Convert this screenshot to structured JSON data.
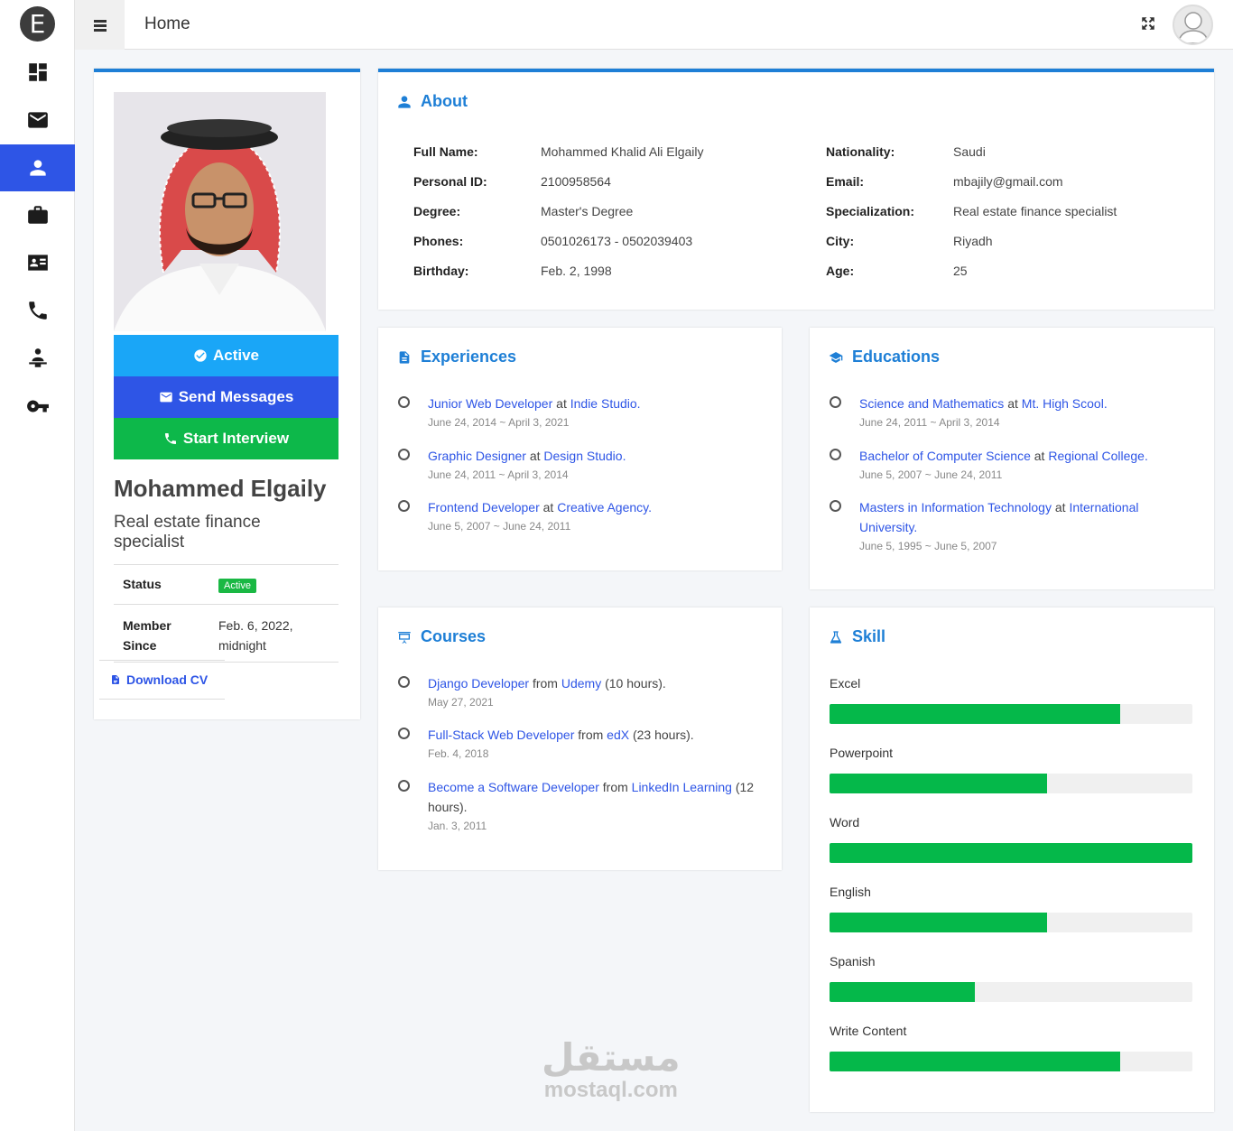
{
  "sidebar": {
    "logo": "E",
    "items": [
      {
        "name": "dashboard-icon"
      },
      {
        "name": "mail-icon"
      },
      {
        "name": "user-icon",
        "active": true
      },
      {
        "name": "briefcase-icon"
      },
      {
        "name": "id-card-icon"
      },
      {
        "name": "phone-icon"
      },
      {
        "name": "person-desk-icon"
      },
      {
        "name": "key-icon"
      }
    ]
  },
  "topbar": {
    "title": "Home"
  },
  "profile": {
    "buttons": {
      "active": "Active",
      "send": "Send Messages",
      "interview": "Start Interview"
    },
    "name": "Mohammed Elgaily",
    "title": "Real estate finance specialist",
    "status_label": "Status",
    "status_value": "Active",
    "member_label": "Member Since",
    "member_value": "Feb. 6, 2022, midnight",
    "download": "Download CV",
    "colors": {
      "active": "#1aa6f7",
      "send": "#2e55e6",
      "interview": "#0db84a"
    }
  },
  "about": {
    "title": "About",
    "left": [
      {
        "k": "Full Name:",
        "v": "Mohammed Khalid Ali Elgaily"
      },
      {
        "k": "Personal ID:",
        "v": "2100958564"
      },
      {
        "k": "Degree:",
        "v": "Master's Degree"
      },
      {
        "k": "Phones:",
        "v": "0501026173 - 0502039403"
      },
      {
        "k": "Birthday:",
        "v": "Feb. 2, 1998"
      }
    ],
    "right": [
      {
        "k": "Nationality:",
        "v": "Saudi"
      },
      {
        "k": "Email:",
        "v": "mbajily@gmail.com"
      },
      {
        "k": "Specialization:",
        "v": "Real estate finance specialist"
      },
      {
        "k": "City:",
        "v": "Riyadh"
      },
      {
        "k": "Age:",
        "v": "25"
      }
    ]
  },
  "experiences": {
    "title": "Experiences",
    "items": [
      {
        "role": "Junior Web Developer",
        "sep": "at",
        "org": "Indie Studio.",
        "date": "June 24, 2014 ~ April 3, 2021"
      },
      {
        "role": "Graphic Designer",
        "sep": "at",
        "org": "Design Studio.",
        "date": "June 24, 2011 ~ April 3, 2014"
      },
      {
        "role": "Frontend Developer",
        "sep": "at",
        "org": "Creative Agency.",
        "date": "June 5, 2007 ~ June 24, 2011"
      }
    ]
  },
  "educations": {
    "title": "Educations",
    "items": [
      {
        "role": "Science and Mathematics",
        "sep": "at",
        "org": "Mt. High Scool.",
        "date": "June 24, 2011 ~ April 3, 2014"
      },
      {
        "role": "Bachelor of Computer Science",
        "sep": "at",
        "org": "Regional College.",
        "date": "June 5, 2007 ~ June 24, 2011"
      },
      {
        "role": "Masters in Information Technology",
        "sep": "at",
        "org": "International University.",
        "date": "June 5, 1995 ~ June 5, 2007"
      }
    ]
  },
  "courses": {
    "title": "Courses",
    "items": [
      {
        "role": "Django Developer",
        "sep": "from",
        "org": "Udemy",
        "extra": "(10 hours).",
        "date": "May 27, 2021"
      },
      {
        "role": "Full-Stack Web Developer",
        "sep": "from",
        "org": "edX",
        "extra": "(23 hours).",
        "date": "Feb. 4, 2018"
      },
      {
        "role": "Become a Software Developer",
        "sep": "from",
        "org": "LinkedIn Learning",
        "extra": "(12 hours).",
        "date": "Jan. 3, 2011"
      }
    ]
  },
  "skills": {
    "title": "Skill",
    "items": [
      {
        "name": "Excel",
        "level": 0.8
      },
      {
        "name": "Powerpoint",
        "level": 0.6
      },
      {
        "name": "Word",
        "level": 1.0
      },
      {
        "name": "English",
        "level": 0.6
      },
      {
        "name": "Spanish",
        "level": 0.4
      },
      {
        "name": "Write Content",
        "level": 0.8
      }
    ]
  },
  "watermark": {
    "ar": "مستقل",
    "en": "mostaql.com"
  }
}
